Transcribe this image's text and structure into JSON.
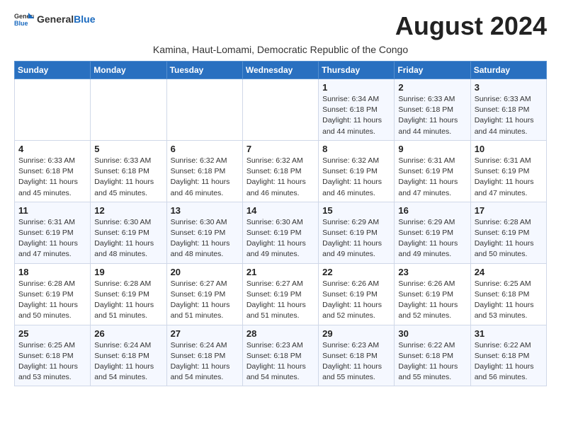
{
  "header": {
    "logo_general": "General",
    "logo_blue": "Blue",
    "month_year": "August 2024",
    "subtitle": "Kamina, Haut-Lomami, Democratic Republic of the Congo"
  },
  "days_of_week": [
    "Sunday",
    "Monday",
    "Tuesday",
    "Wednesday",
    "Thursday",
    "Friday",
    "Saturday"
  ],
  "weeks": [
    [
      {
        "day": "",
        "info": ""
      },
      {
        "day": "",
        "info": ""
      },
      {
        "day": "",
        "info": ""
      },
      {
        "day": "",
        "info": ""
      },
      {
        "day": "1",
        "info": "Sunrise: 6:34 AM\nSunset: 6:18 PM\nDaylight: 11 hours and 44 minutes."
      },
      {
        "day": "2",
        "info": "Sunrise: 6:33 AM\nSunset: 6:18 PM\nDaylight: 11 hours and 44 minutes."
      },
      {
        "day": "3",
        "info": "Sunrise: 6:33 AM\nSunset: 6:18 PM\nDaylight: 11 hours and 44 minutes."
      }
    ],
    [
      {
        "day": "4",
        "info": "Sunrise: 6:33 AM\nSunset: 6:18 PM\nDaylight: 11 hours and 45 minutes."
      },
      {
        "day": "5",
        "info": "Sunrise: 6:33 AM\nSunset: 6:18 PM\nDaylight: 11 hours and 45 minutes."
      },
      {
        "day": "6",
        "info": "Sunrise: 6:32 AM\nSunset: 6:18 PM\nDaylight: 11 hours and 46 minutes."
      },
      {
        "day": "7",
        "info": "Sunrise: 6:32 AM\nSunset: 6:18 PM\nDaylight: 11 hours and 46 minutes."
      },
      {
        "day": "8",
        "info": "Sunrise: 6:32 AM\nSunset: 6:19 PM\nDaylight: 11 hours and 46 minutes."
      },
      {
        "day": "9",
        "info": "Sunrise: 6:31 AM\nSunset: 6:19 PM\nDaylight: 11 hours and 47 minutes."
      },
      {
        "day": "10",
        "info": "Sunrise: 6:31 AM\nSunset: 6:19 PM\nDaylight: 11 hours and 47 minutes."
      }
    ],
    [
      {
        "day": "11",
        "info": "Sunrise: 6:31 AM\nSunset: 6:19 PM\nDaylight: 11 hours and 47 minutes."
      },
      {
        "day": "12",
        "info": "Sunrise: 6:30 AM\nSunset: 6:19 PM\nDaylight: 11 hours and 48 minutes."
      },
      {
        "day": "13",
        "info": "Sunrise: 6:30 AM\nSunset: 6:19 PM\nDaylight: 11 hours and 48 minutes."
      },
      {
        "day": "14",
        "info": "Sunrise: 6:30 AM\nSunset: 6:19 PM\nDaylight: 11 hours and 49 minutes."
      },
      {
        "day": "15",
        "info": "Sunrise: 6:29 AM\nSunset: 6:19 PM\nDaylight: 11 hours and 49 minutes."
      },
      {
        "day": "16",
        "info": "Sunrise: 6:29 AM\nSunset: 6:19 PM\nDaylight: 11 hours and 49 minutes."
      },
      {
        "day": "17",
        "info": "Sunrise: 6:28 AM\nSunset: 6:19 PM\nDaylight: 11 hours and 50 minutes."
      }
    ],
    [
      {
        "day": "18",
        "info": "Sunrise: 6:28 AM\nSunset: 6:19 PM\nDaylight: 11 hours and 50 minutes."
      },
      {
        "day": "19",
        "info": "Sunrise: 6:28 AM\nSunset: 6:19 PM\nDaylight: 11 hours and 51 minutes."
      },
      {
        "day": "20",
        "info": "Sunrise: 6:27 AM\nSunset: 6:19 PM\nDaylight: 11 hours and 51 minutes."
      },
      {
        "day": "21",
        "info": "Sunrise: 6:27 AM\nSunset: 6:19 PM\nDaylight: 11 hours and 51 minutes."
      },
      {
        "day": "22",
        "info": "Sunrise: 6:26 AM\nSunset: 6:19 PM\nDaylight: 11 hours and 52 minutes."
      },
      {
        "day": "23",
        "info": "Sunrise: 6:26 AM\nSunset: 6:19 PM\nDaylight: 11 hours and 52 minutes."
      },
      {
        "day": "24",
        "info": "Sunrise: 6:25 AM\nSunset: 6:18 PM\nDaylight: 11 hours and 53 minutes."
      }
    ],
    [
      {
        "day": "25",
        "info": "Sunrise: 6:25 AM\nSunset: 6:18 PM\nDaylight: 11 hours and 53 minutes."
      },
      {
        "day": "26",
        "info": "Sunrise: 6:24 AM\nSunset: 6:18 PM\nDaylight: 11 hours and 54 minutes."
      },
      {
        "day": "27",
        "info": "Sunrise: 6:24 AM\nSunset: 6:18 PM\nDaylight: 11 hours and 54 minutes."
      },
      {
        "day": "28",
        "info": "Sunrise: 6:23 AM\nSunset: 6:18 PM\nDaylight: 11 hours and 54 minutes."
      },
      {
        "day": "29",
        "info": "Sunrise: 6:23 AM\nSunset: 6:18 PM\nDaylight: 11 hours and 55 minutes."
      },
      {
        "day": "30",
        "info": "Sunrise: 6:22 AM\nSunset: 6:18 PM\nDaylight: 11 hours and 55 minutes."
      },
      {
        "day": "31",
        "info": "Sunrise: 6:22 AM\nSunset: 6:18 PM\nDaylight: 11 hours and 56 minutes."
      }
    ]
  ]
}
